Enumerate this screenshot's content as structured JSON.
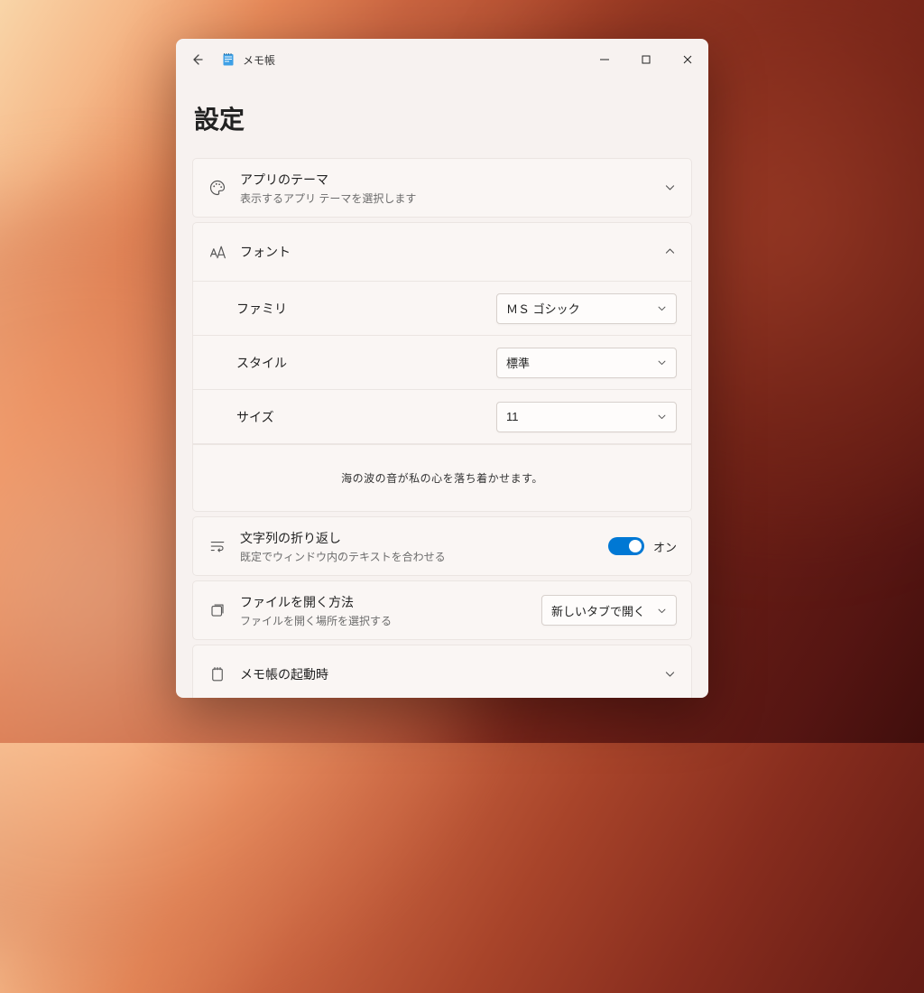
{
  "window": {
    "app_title": "メモ帳"
  },
  "page": {
    "title": "設定"
  },
  "theme": {
    "title": "アプリのテーマ",
    "subtitle": "表示するアプリ テーマを選択します"
  },
  "font": {
    "title": "フォント",
    "family_label": "ファミリ",
    "family_value": "ＭＳ ゴシック",
    "style_label": "スタイル",
    "style_value": "標準",
    "size_label": "サイズ",
    "size_value": "11",
    "preview_text": "海の波の音が私の心を落ち着かせます。"
  },
  "wrap": {
    "title": "文字列の折り返し",
    "subtitle": "既定でウィンドウ内のテキストを合わせる",
    "state_label": "オン"
  },
  "open": {
    "title": "ファイルを開く方法",
    "subtitle": "ファイルを開く場所を選択する",
    "value": "新しいタブで開く"
  },
  "startup": {
    "title": "メモ帳の起動時"
  }
}
